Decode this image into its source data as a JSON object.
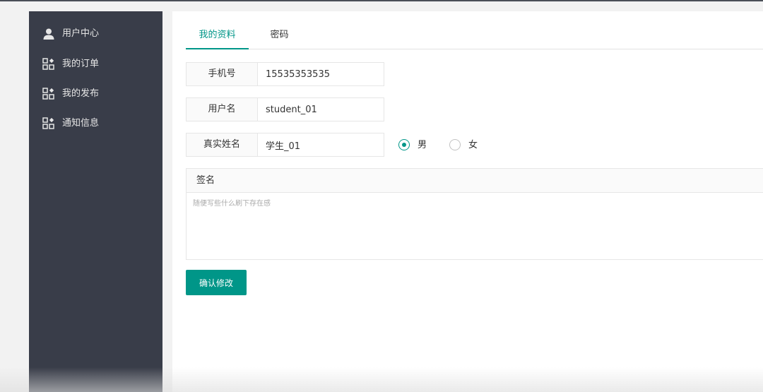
{
  "sidebar": {
    "items": [
      {
        "label": "用户中心",
        "icon": "user-icon"
      },
      {
        "label": "我的订单",
        "icon": "app-grid-icon"
      },
      {
        "label": "我的发布",
        "icon": "app-grid-icon"
      },
      {
        "label": "通知信息",
        "icon": "app-grid-icon"
      }
    ]
  },
  "tabs": [
    {
      "label": "我的资料",
      "active": true
    },
    {
      "label": "密码",
      "active": false
    }
  ],
  "form": {
    "phone": {
      "label": "手机号",
      "value": "15535353535"
    },
    "username": {
      "label": "用户名",
      "value": "student_01"
    },
    "realname": {
      "label": "真实姓名",
      "value": "学生_01"
    },
    "gender": {
      "options": [
        {
          "label": "男",
          "checked": true
        },
        {
          "label": "女",
          "checked": false
        }
      ]
    },
    "signature": {
      "label": "签名",
      "placeholder": "随便写些什么刷下存在感",
      "value": ""
    },
    "submit_label": "确认修改"
  },
  "colors": {
    "accent": "#009688",
    "sidebar_bg": "#393d49"
  }
}
